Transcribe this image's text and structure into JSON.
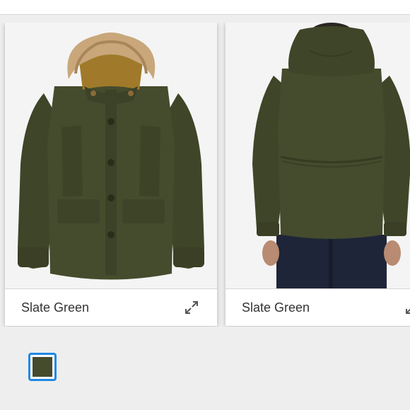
{
  "product_images": [
    {
      "view": "front",
      "color_label": "Slate Green",
      "expand_icon": "expand-icon"
    },
    {
      "view": "back",
      "color_label": "Slate Green",
      "expand_icon": "expand-icon"
    }
  ],
  "swatches": [
    {
      "name": "Slate Green",
      "selected": true,
      "color": "#454b2d"
    }
  ],
  "colors": {
    "jacket": "#454b2d",
    "fur": "#c9a77a",
    "selection_accent": "#1e88e5"
  }
}
